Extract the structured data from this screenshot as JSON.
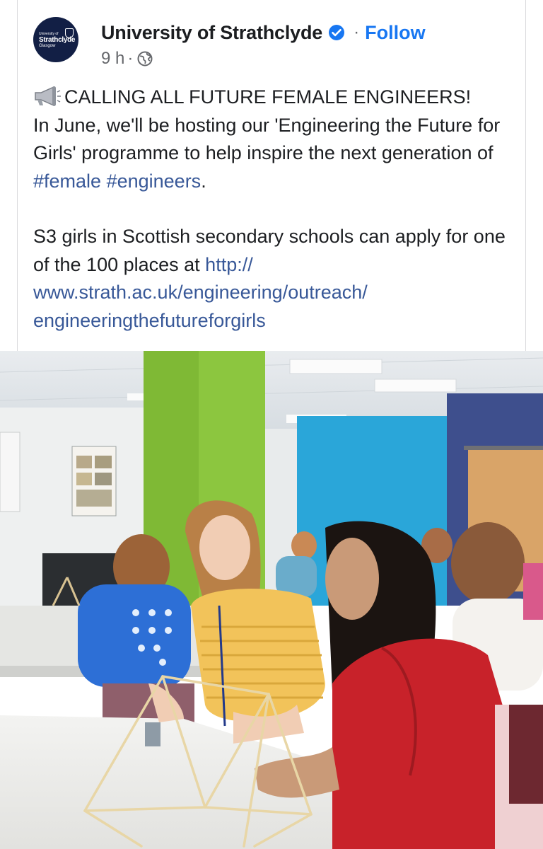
{
  "post": {
    "page_name": "University of Strathclyde",
    "follow_label": "Follow",
    "separator": "·",
    "time_ago": "9 h",
    "avatar": {
      "line1": "University of",
      "line2": "Strathclyde",
      "line3": "Glasgow"
    },
    "text": {
      "line1": "CALLING ALL FUTURE FEMALE ENGINEERS!",
      "para1_prefix": "In June, we'll be hosting our 'Engineering the Future for Girls' programme to help inspire the next generation of ",
      "hashtag1": "#female",
      "hashtag2": "#engineers",
      "para1_suffix": ".",
      "para2_prefix": "S3 girls in Scottish secondary schools can apply for one of the 100 places at ",
      "link_line1": "http://",
      "link_line2": "www.strath.ac.uk/engineering/outreach/",
      "link_line3": "engineeringthefutureforgirls"
    },
    "icons": {
      "verified": "verified-badge-icon",
      "globe": "globe-icon",
      "megaphone": "megaphone-emoji-icon"
    }
  },
  "colors": {
    "accent": "#1877f2",
    "link": "#385898",
    "secondary_text": "#65676b",
    "avatar_bg": "#121f45"
  }
}
